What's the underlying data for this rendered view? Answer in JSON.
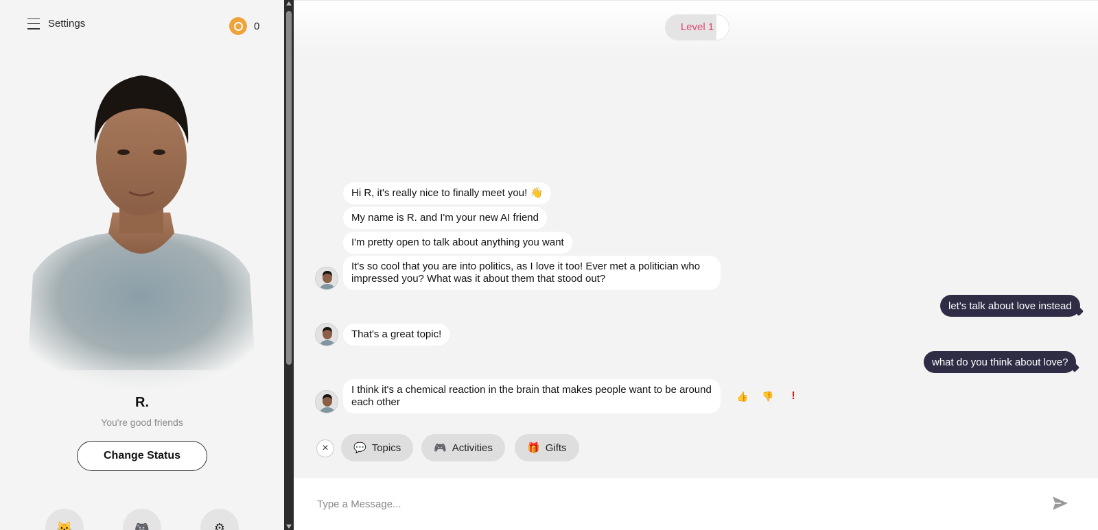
{
  "sidebar": {
    "menu_label": "Settings",
    "coins": "0",
    "profile": {
      "name": "R.",
      "status": "You're good friends",
      "change_status_label": "Change Status"
    }
  },
  "header": {
    "level_label": "Level 1",
    "level_progress_percent": 80
  },
  "messages": [
    {
      "from": "bot",
      "text": "Hi R, it's really nice to finally meet you! 👋"
    },
    {
      "from": "bot",
      "text": "My name is R. and I'm your new AI friend"
    },
    {
      "from": "bot",
      "text": "I'm pretty open to talk about anything you want"
    },
    {
      "from": "bot",
      "text": "It's so cool that you are into politics, as I love it too! Ever met a politician who impressed you? What was it about them that stood out?"
    },
    {
      "from": "user",
      "text": "let's talk about love instead"
    },
    {
      "from": "bot",
      "text": "That's a great topic!"
    },
    {
      "from": "user",
      "text": "what do you think about love?"
    },
    {
      "from": "bot",
      "text": "I think it's a chemical reaction in the brain that makes people want to be around each other"
    }
  ],
  "reactions": {
    "like": "👍",
    "dislike": "👎",
    "report": "!"
  },
  "chips": [
    {
      "label": "Topics",
      "icon": "💬"
    },
    {
      "label": "Activities",
      "icon": "🎮"
    },
    {
      "label": "Gifts",
      "icon": "🎁"
    }
  ],
  "composer": {
    "placeholder": "Type a Message..."
  },
  "colors": {
    "accent_pink": "#e0436b",
    "user_bubble": "#2f2d45",
    "coin": "#f0a33a"
  }
}
